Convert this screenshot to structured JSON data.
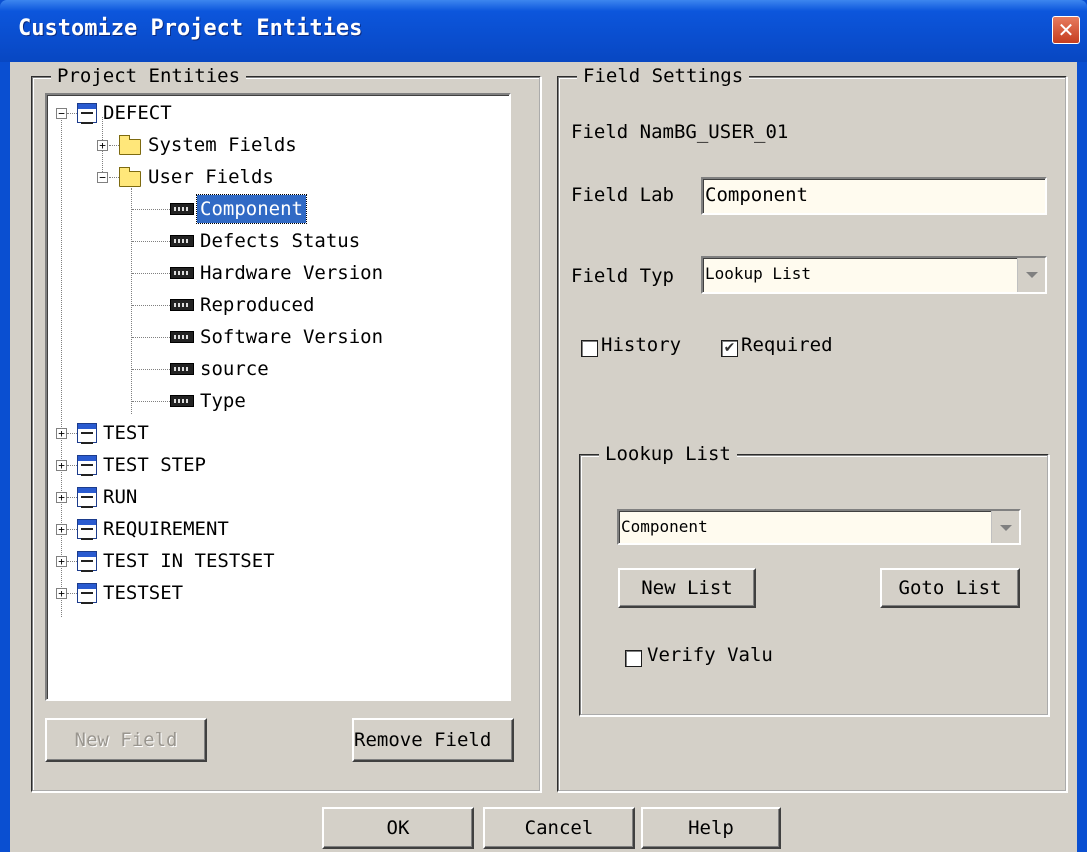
{
  "window": {
    "title": "Customize Project Entities",
    "close_glyph": "✕"
  },
  "project_entities": {
    "legend": "Project Entities",
    "tree": {
      "defect": "DEFECT",
      "system_fields": "System Fields",
      "user_fields": "User Fields",
      "fields": [
        "Component",
        "Defects Status",
        "Hardware Version",
        "Reproduced",
        "Software Version",
        "source",
        "Type"
      ],
      "selected_field": "Component",
      "entities": [
        "TEST",
        "TEST STEP",
        "RUN",
        "REQUIREMENT",
        "TEST IN TESTSET",
        "TESTSET"
      ]
    },
    "new_field_button": "New Field",
    "remove_field_button": "Remove Field"
  },
  "field_settings": {
    "legend": "Field Settings",
    "field_name_label": "Field Nam",
    "field_name_value": "BG_USER_01",
    "field_label_label": "Field Lab",
    "field_label_value": "Component",
    "field_type_label": "Field Typ",
    "field_type_value": "Lookup List",
    "history_label": "History",
    "history_checked": false,
    "required_label": "Required",
    "required_checked": true,
    "lookup_list": {
      "legend": "Lookup List",
      "selected": "Component",
      "new_list_button": "New List",
      "goto_list_button": "Goto List",
      "verify_value_label": "Verify Valu",
      "verify_value_checked": false
    }
  },
  "footer": {
    "ok": "OK",
    "cancel": "Cancel",
    "help": "Help"
  }
}
